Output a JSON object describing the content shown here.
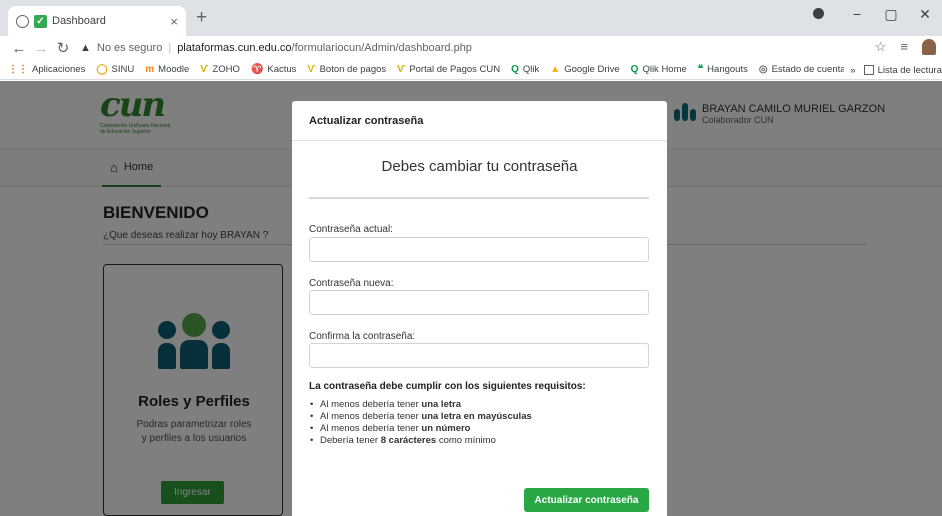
{
  "browser": {
    "tab_title": "Dashboard",
    "tab_close": "×",
    "new_tab": "+",
    "window_controls": [
      "−",
      "▢",
      "✕"
    ],
    "address": {
      "security": "No es seguro",
      "host": "plataformas.cun.edu.co",
      "path": "/formulariocun/Admin/dashboard.php"
    },
    "bookmarks": [
      {
        "label": "Aplicaciones",
        "icon": "apps-grid-icon",
        "color": "#e8710a"
      },
      {
        "label": "SINU",
        "icon": "sinu-icon",
        "color": "#e8a50a"
      },
      {
        "label": "Moodle",
        "icon": "moodle-icon",
        "color": "#f98012"
      },
      {
        "label": "ZOHO",
        "icon": "zoho-icon",
        "color": "#d8b200"
      },
      {
        "label": "Kactus",
        "icon": "kactus-icon",
        "color": "#1a73e8"
      },
      {
        "label": "Boton de pagos",
        "icon": "payments-icon",
        "color": "#d8b200"
      },
      {
        "label": "Portal de Pagos CUN",
        "icon": "payments-portal-icon",
        "color": "#d8b200"
      },
      {
        "label": "Qlik",
        "icon": "qlik-icon",
        "color": "#009845"
      },
      {
        "label": "Google Drive",
        "icon": "drive-icon",
        "color": "#f4b400"
      },
      {
        "label": "Qlik Home",
        "icon": "qlik-home-icon",
        "color": "#009845"
      },
      {
        "label": "Hangouts",
        "icon": "hangouts-icon",
        "color": "#0f9d58"
      },
      {
        "label": "Estado de cuenta",
        "icon": "globe-icon",
        "color": "#5f6368"
      }
    ],
    "bookmarks_more": "»",
    "reading_list": "Lista de lectura"
  },
  "header": {
    "logo_mark": "cun",
    "logo_line1": "Corporación Unificada Nacional",
    "logo_line2": "de Educación Superior",
    "user_name": "BRAYAN CAMILO MURIEL GARZON",
    "user_role": "Colaborador CUN"
  },
  "nav": {
    "home_label": "Home"
  },
  "main": {
    "welcome_title": "BIENVENIDO",
    "welcome_sub": "¿Que deseas realizar hoy BRAYAN ?",
    "card": {
      "title": "Roles y Perfiles",
      "description": "Podras parametrizar roles y perfiles a los usuarios",
      "button": "Ingresar"
    }
  },
  "modal": {
    "title": "Actualizar contraseña",
    "subtitle": "Debes cambiar tu contraseña",
    "current_label": "Contraseña actual:",
    "new_label": "Contraseña nueva:",
    "confirm_label": "Confirma la contraseña:",
    "current_value": "",
    "new_value": "",
    "confirm_value": "",
    "requirements_title": "La contraseña debe cumplir con los siguientes requisitos:",
    "requirements": [
      {
        "pre": "Al menos debería tener ",
        "bold": "una letra",
        "post": ""
      },
      {
        "pre": "Al menos debería tener ",
        "bold": "una letra en mayúsculas",
        "post": ""
      },
      {
        "pre": "Al menos debería tener ",
        "bold": "un número",
        "post": ""
      },
      {
        "pre": "Debería tener ",
        "bold": "8 carácteres",
        "post": " como mínimo"
      }
    ],
    "submit": "Actualizar contraseña"
  },
  "colors": {
    "accent_green": "#2aa745",
    "brand_green": "#2e8a2e",
    "brand_teal": "#0e6b76",
    "overlay": "rgba(0,0,0,0.5)"
  }
}
